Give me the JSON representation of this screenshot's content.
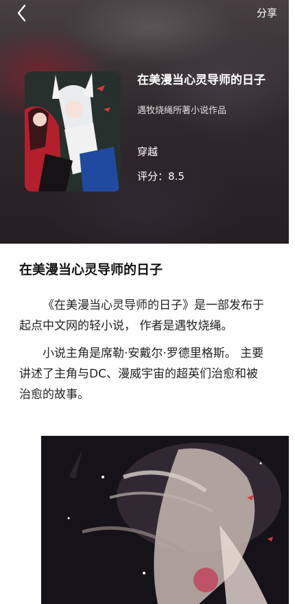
{
  "nav": {
    "share_label": "分享"
  },
  "book": {
    "title": "在美漫当心灵导师的日子",
    "author_line": "遇牧烧绳所著小说作品",
    "genre": "穿越",
    "rating_label": "评分：",
    "rating_value": "8.5"
  },
  "article": {
    "heading": "在美漫当心灵导师的日子",
    "paragraph1": "《在美漫当心灵导师的日子》是一部发布于起点中文网的轻小说， 作者是遇牧烧绳。",
    "paragraph2": "小说主角是席勒·安戴尔·罗德里格斯。 主要讲述了主角与DC、漫威宇宙的超英们治愈和被治愈的故事。"
  },
  "icons": {
    "back": "chevron-left-icon"
  }
}
